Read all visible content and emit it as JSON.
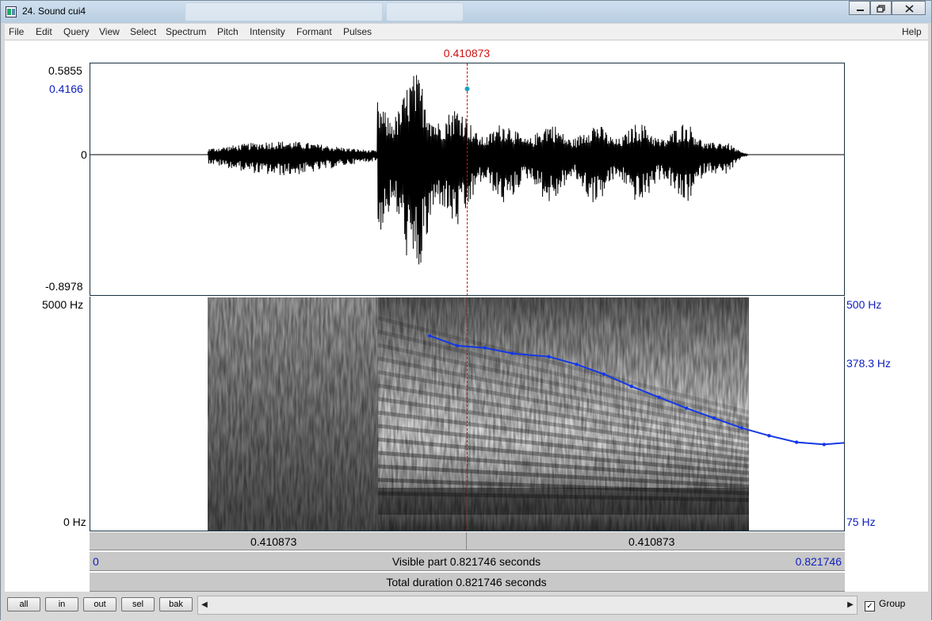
{
  "window": {
    "title": "24. Sound cui4"
  },
  "menu": [
    "File",
    "Edit",
    "Query",
    "View",
    "Select",
    "Spectrum",
    "Pitch",
    "Intensity",
    "Formant",
    "Pulses"
  ],
  "menu_help": "Help",
  "cursor": {
    "time_label": "0.410873",
    "time_fraction": 0.5
  },
  "waveform": {
    "amp_max": "0.5855",
    "amp_cursor": "0.4166",
    "amp_zero": "0",
    "amp_min": "-0.8978"
  },
  "spectrogram": {
    "freq_top": "5000 Hz",
    "freq_bottom": "0 Hz",
    "pitch_top": "500 Hz",
    "pitch_cursor": "378.3 Hz",
    "pitch_bottom": "75 Hz"
  },
  "pitch_contour": {
    "t": [
      0.37,
      0.4,
      0.43,
      0.46,
      0.5,
      0.53,
      0.56,
      0.59,
      0.62,
      0.65,
      0.68,
      0.71,
      0.74,
      0.77,
      0.8,
      0.83,
      0.86
    ],
    "hz": [
      430,
      412,
      408,
      398,
      392,
      378,
      360,
      338,
      318,
      298,
      280,
      262,
      248,
      236,
      232,
      236,
      240
    ]
  },
  "bars": {
    "left_cursor": "0.410873",
    "right_cursor": "0.410873",
    "visible_start": "0",
    "visible_text": "Visible part 0.821746 seconds",
    "visible_end": "0.821746",
    "total_text": "Total duration 0.821746 seconds"
  },
  "buttons": {
    "all": "all",
    "in": "in",
    "out": "out",
    "sel": "sel",
    "bak": "bak"
  },
  "group": {
    "label": "Group",
    "checked": true
  },
  "colors": {
    "cursor_red": "#d01010",
    "pitch_blue": "#1438e6",
    "axis_blue": "#1020c0"
  }
}
